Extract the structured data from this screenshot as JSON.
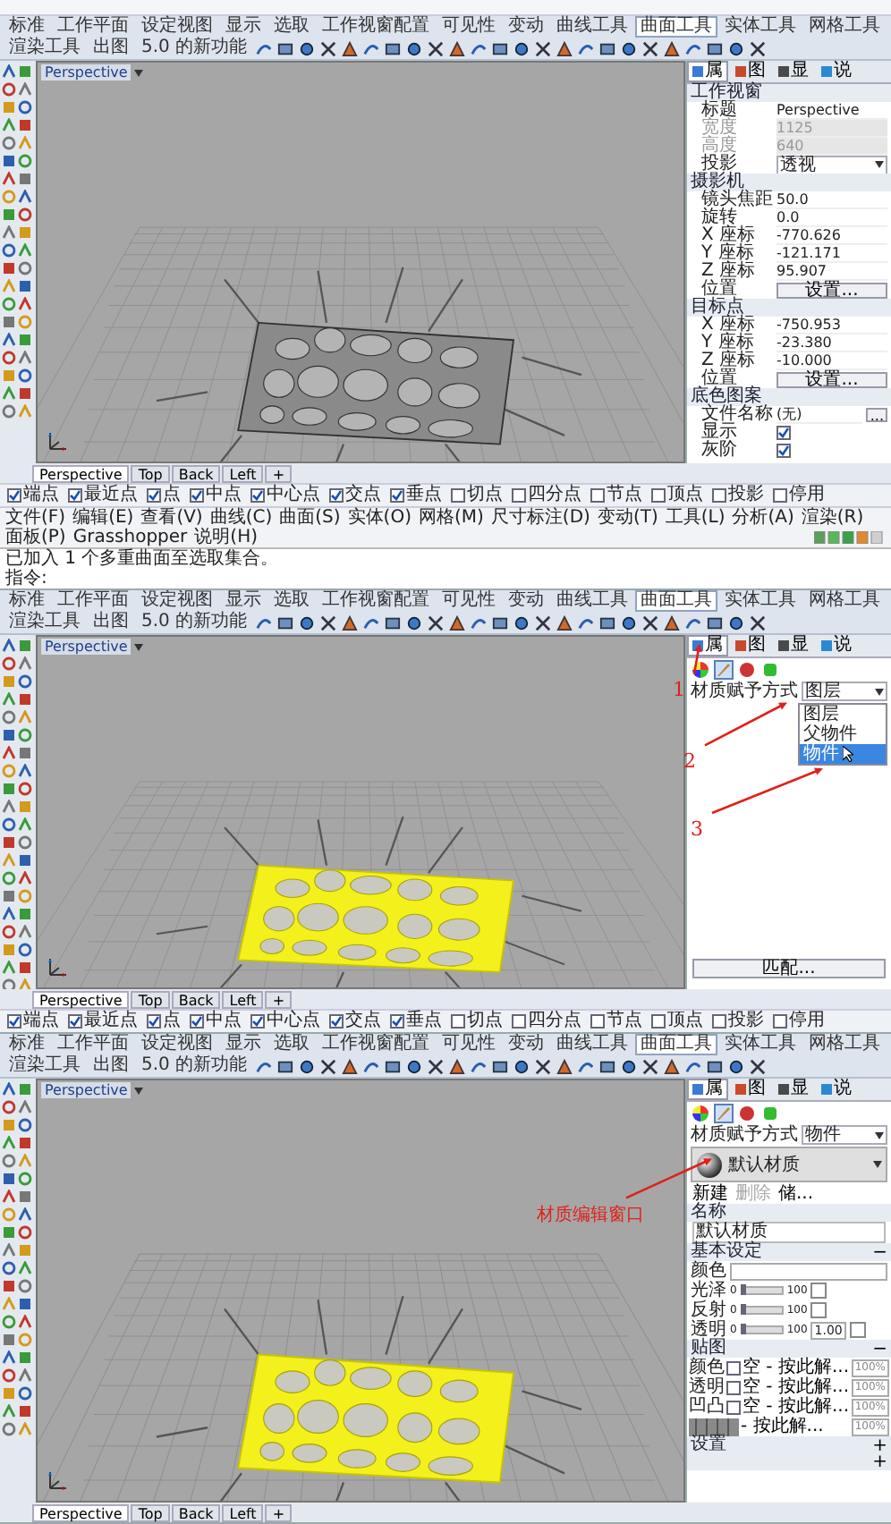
{
  "screens": [
    {
      "ribbon_tabs": [
        {
          "label": "标准",
          "selected": false
        },
        {
          "label": "工作平面",
          "selected": false
        },
        {
          "label": "设定视图",
          "selected": false
        },
        {
          "label": "显示",
          "selected": false
        },
        {
          "label": "选取",
          "selected": false
        },
        {
          "label": "工作视窗配置",
          "selected": false
        },
        {
          "label": "可见性",
          "selected": false
        },
        {
          "label": "变动",
          "selected": false
        },
        {
          "label": "曲线工具",
          "selected": false
        },
        {
          "label": "曲面工具",
          "selected": true
        },
        {
          "label": "实体工具",
          "selected": false
        },
        {
          "label": "网格工具",
          "selected": false
        },
        {
          "label": "渲染工具",
          "selected": false
        },
        {
          "label": "出图",
          "selected": false
        },
        {
          "label": "5.0 的新功能",
          "selected": false
        }
      ],
      "viewport": {
        "title": "Perspective",
        "model_selected": false
      },
      "viewport_tabs": [
        {
          "label": "Perspective",
          "selected": true
        },
        {
          "label": "Top",
          "selected": false
        },
        {
          "label": "Back",
          "selected": false
        },
        {
          "label": "Left",
          "selected": false
        }
      ],
      "add_tab": "+",
      "osnaps": [
        {
          "label": "端点",
          "checked": true
        },
        {
          "label": "最近点",
          "checked": true
        },
        {
          "label": "点",
          "checked": true
        },
        {
          "label": "中点",
          "checked": true
        },
        {
          "label": "中心点",
          "checked": true
        },
        {
          "label": "交点",
          "checked": true
        },
        {
          "label": "垂点",
          "checked": true
        },
        {
          "label": "切点",
          "checked": false
        },
        {
          "label": "四分点",
          "checked": false
        },
        {
          "label": "节点",
          "checked": false
        },
        {
          "label": "顶点",
          "checked": false
        },
        {
          "label": "投影",
          "checked": false
        },
        {
          "label": "停用",
          "checked": false
        }
      ],
      "menu": [
        "文件(F)",
        "编辑(E)",
        "查看(V)",
        "曲线(C)",
        "曲面(S)",
        "实体(O)",
        "网格(M)",
        "尺寸标注(D)",
        "变动(T)",
        "工具(L)",
        "分析(A)",
        "渲染(R)",
        "面板(P)",
        "Grasshopper",
        "说明(H)"
      ],
      "command_lines": [
        "已加入 1 个多重曲面至选取集合。",
        "指令:"
      ],
      "side_panel": {
        "kind": "viewport",
        "tabs": [
          {
            "label": "属",
            "selected": true
          },
          {
            "label": "图",
            "selected": false
          },
          {
            "label": "显",
            "selected": false
          },
          {
            "label": "说",
            "selected": false
          }
        ],
        "sections": [
          {
            "title": "工作视窗",
            "rows": [
              {
                "kind": "text",
                "label": "标题",
                "value": "Perspective",
                "disabled": false
              },
              {
                "kind": "text",
                "label": "宽度",
                "value": "1125",
                "disabled": true
              },
              {
                "kind": "text",
                "label": "高度",
                "value": "640",
                "disabled": true
              },
              {
                "kind": "dropdown",
                "label": "投影",
                "value": "透视",
                "disabled": false
              }
            ]
          },
          {
            "title": "摄影机",
            "rows": [
              {
                "kind": "text",
                "label": "镜头焦距",
                "value": "50.0",
                "disabled": false
              },
              {
                "kind": "text",
                "label": "旋转",
                "value": "0.0",
                "disabled": false
              },
              {
                "kind": "text",
                "label": "X 座标",
                "value": "-770.626",
                "disabled": false
              },
              {
                "kind": "text",
                "label": "Y 座标",
                "value": "-121.171",
                "disabled": false
              },
              {
                "kind": "text",
                "label": "Z 座标",
                "value": "95.907",
                "disabled": false
              },
              {
                "kind": "button",
                "label": "位置",
                "value": "设置...",
                "disabled": false
              }
            ]
          },
          {
            "title": "目标点",
            "rows": [
              {
                "kind": "text",
                "label": "X 座标",
                "value": "-750.953",
                "disabled": false
              },
              {
                "kind": "text",
                "label": "Y 座标",
                "value": "-23.380",
                "disabled": false
              },
              {
                "kind": "text",
                "label": "Z 座标",
                "value": "-10.000",
                "disabled": false
              },
              {
                "kind": "button",
                "label": "位置",
                "value": "设置...",
                "disabled": false
              }
            ]
          },
          {
            "title": "底色图案",
            "rows": [
              {
                "kind": "file",
                "label": "文件名称",
                "value": "(无)",
                "button": "...",
                "disabled": false
              },
              {
                "kind": "check",
                "label": "显示",
                "checked": true,
                "disabled": false
              },
              {
                "kind": "check",
                "label": "灰阶",
                "checked": true,
                "disabled": false
              }
            ]
          }
        ]
      }
    },
    {
      "ribbon_tabs": [
        {
          "label": "标准",
          "selected": false
        },
        {
          "label": "工作平面",
          "selected": false
        },
        {
          "label": "设定视图",
          "selected": false
        },
        {
          "label": "显示",
          "selected": false
        },
        {
          "label": "选取",
          "selected": false
        },
        {
          "label": "工作视窗配置",
          "selected": false
        },
        {
          "label": "可见性",
          "selected": false
        },
        {
          "label": "变动",
          "selected": false
        },
        {
          "label": "曲线工具",
          "selected": false
        },
        {
          "label": "曲面工具",
          "selected": true
        },
        {
          "label": "实体工具",
          "selected": false
        },
        {
          "label": "网格工具",
          "selected": false
        },
        {
          "label": "渲染工具",
          "selected": false
        },
        {
          "label": "出图",
          "selected": false
        },
        {
          "label": "5.0 的新功能",
          "selected": false
        }
      ],
      "viewport": {
        "title": "Perspective",
        "model_selected": true
      },
      "viewport_tabs": [
        {
          "label": "Perspective",
          "selected": true
        },
        {
          "label": "Top",
          "selected": false
        },
        {
          "label": "Back",
          "selected": false
        },
        {
          "label": "Left",
          "selected": false
        }
      ],
      "add_tab": "+",
      "osnaps": [
        {
          "label": "端点",
          "checked": true
        },
        {
          "label": "最近点",
          "checked": true
        },
        {
          "label": "点",
          "checked": true
        },
        {
          "label": "中点",
          "checked": true
        },
        {
          "label": "中心点",
          "checked": true
        },
        {
          "label": "交点",
          "checked": true
        },
        {
          "label": "垂点",
          "checked": true
        },
        {
          "label": "切点",
          "checked": false
        },
        {
          "label": "四分点",
          "checked": false
        },
        {
          "label": "节点",
          "checked": false
        },
        {
          "label": "顶点",
          "checked": false
        },
        {
          "label": "投影",
          "checked": false
        },
        {
          "label": "停用",
          "checked": false
        }
      ],
      "side_panel": {
        "kind": "material_menu",
        "tabs": [
          {
            "label": "属",
            "selected": true
          },
          {
            "label": "图",
            "selected": false
          },
          {
            "label": "显",
            "selected": false
          },
          {
            "label": "说",
            "selected": false
          }
        ],
        "tools": [
          {
            "selected": false
          },
          {
            "selected": true
          },
          {
            "selected": false
          },
          {
            "selected": false
          }
        ],
        "assign_label": "材质赋予方式",
        "assign_value": "图层",
        "options": [
          {
            "label": "图层",
            "selected": false
          },
          {
            "label": "父物件",
            "selected": false
          },
          {
            "label": "物件",
            "selected": true
          }
        ],
        "button": "匹配..."
      },
      "annotations": [
        "1",
        "2",
        "3"
      ]
    },
    {
      "ribbon_tabs": [
        {
          "label": "标准",
          "selected": false
        },
        {
          "label": "工作平面",
          "selected": false
        },
        {
          "label": "设定视图",
          "selected": false
        },
        {
          "label": "显示",
          "selected": false
        },
        {
          "label": "选取",
          "selected": false
        },
        {
          "label": "工作视窗配置",
          "selected": false
        },
        {
          "label": "可见性",
          "selected": false
        },
        {
          "label": "变动",
          "selected": false
        },
        {
          "label": "曲线工具",
          "selected": false
        },
        {
          "label": "曲面工具",
          "selected": true
        },
        {
          "label": "实体工具",
          "selected": false
        },
        {
          "label": "网格工具",
          "selected": false
        },
        {
          "label": "渲染工具",
          "selected": false
        },
        {
          "label": "出图",
          "selected": false
        },
        {
          "label": "5.0 的新功能",
          "selected": false
        }
      ],
      "viewport": {
        "title": "Perspective",
        "model_selected": true
      },
      "viewport_tabs": [
        {
          "label": "Perspective",
          "selected": true
        },
        {
          "label": "Top",
          "selected": false
        },
        {
          "label": "Back",
          "selected": false
        },
        {
          "label": "Left",
          "selected": false
        }
      ],
      "add_tab": "+",
      "side_panel": {
        "kind": "material_editor",
        "tabs": [
          {
            "label": "属",
            "selected": true
          },
          {
            "label": "图",
            "selected": false
          },
          {
            "label": "显",
            "selected": false
          },
          {
            "label": "说",
            "selected": false
          }
        ],
        "tools": [
          {
            "selected": false
          },
          {
            "selected": true
          },
          {
            "selected": false
          },
          {
            "selected": false
          }
        ],
        "assign_label": "材质赋予方式",
        "assign_value": "物件",
        "material_name": "默认材质",
        "actions": [
          {
            "label": "新建",
            "disabled": false
          },
          {
            "label": "删除",
            "disabled": true
          },
          {
            "label": "储...",
            "disabled": false
          }
        ],
        "sections": [
          {
            "kind": "name",
            "title": "名称",
            "value": "默认材质"
          },
          {
            "kind": "basic",
            "title": "基本设定",
            "toggle": "−",
            "rows": [
              {
                "kind": "color",
                "label": "颜色"
              },
              {
                "kind": "slider",
                "label": "光泽",
                "min": "0",
                "max": "100",
                "level": 0
              },
              {
                "kind": "slider",
                "label": "反射",
                "min": "0",
                "max": "100",
                "level": 0
              },
              {
                "kind": "slider",
                "label": "透明",
                "min": "0",
                "max": "100",
                "level": 0,
                "ior": "1.00"
              }
            ]
          },
          {
            "kind": "maps",
            "title": "贴图",
            "toggle": "−",
            "rows": [
              {
                "kind": "empty",
                "label": "颜色",
                "checked": false,
                "slot": "空 - 按此解...",
                "amount": "100%"
              },
              {
                "kind": "empty",
                "label": "透明",
                "checked": false,
                "slot": "空 - 按此解...",
                "amount": "100%"
              },
              {
                "kind": "empty",
                "label": "凹凸",
                "checked": false,
                "slot": "空 - 按此解...",
                "amount": "100%"
              },
              {
                "kind": "texture",
                "slot": "- 按此解...",
                "amount": "100%"
              }
            ]
          },
          {
            "kind": "collapsed",
            "title": "设置",
            "toggle": "+"
          },
          {
            "kind": "collapsed",
            "toggle": "+"
          }
        ]
      },
      "annotations": [
        "材质编辑窗口"
      ]
    }
  ]
}
